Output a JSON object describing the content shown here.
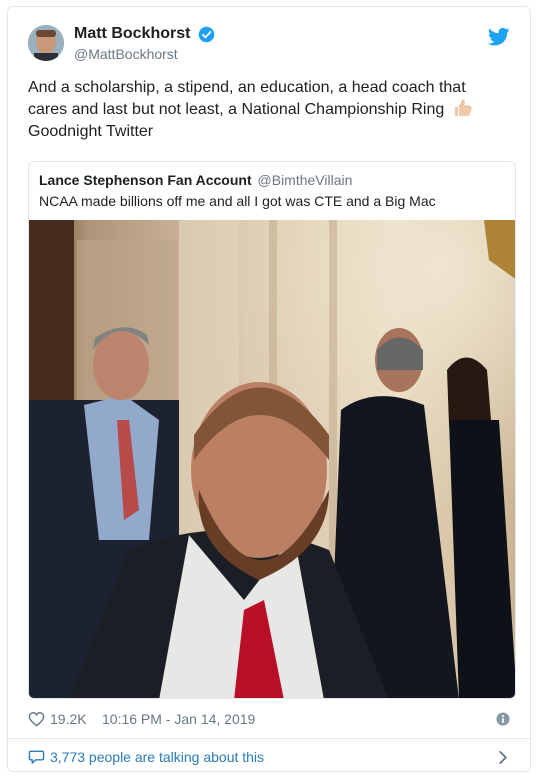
{
  "author": {
    "display_name": "Matt Bockhorst",
    "handle": "@MattBockhorst",
    "verified": true,
    "avatar_icon": "avatar-photo"
  },
  "tweet": {
    "text": "And a scholarship, a stipend, an education, a head coach that cares and last but not least, a National Championship Ring",
    "text_end": "Goodnight Twitter",
    "emoji": "thumbs-up-icon"
  },
  "quoted_tweet": {
    "display_name": "Lance Stephenson Fan Account",
    "handle": "@BimtheVillain",
    "text": "NCAA made billions off me and all I got was CTE and a Big Mac",
    "photo_icon": "photo-of-people-in-formal-room"
  },
  "meta": {
    "like_count": "19.2K",
    "timestamp": "10:16 PM - Jan 14, 2019"
  },
  "conversation": {
    "label": "3,773 people are talking about this"
  },
  "colors": {
    "twitter_blue": "#1da1f2",
    "link_blue": "#2b7bb9",
    "secondary_text": "#697882",
    "border": "#e1e8ed"
  }
}
